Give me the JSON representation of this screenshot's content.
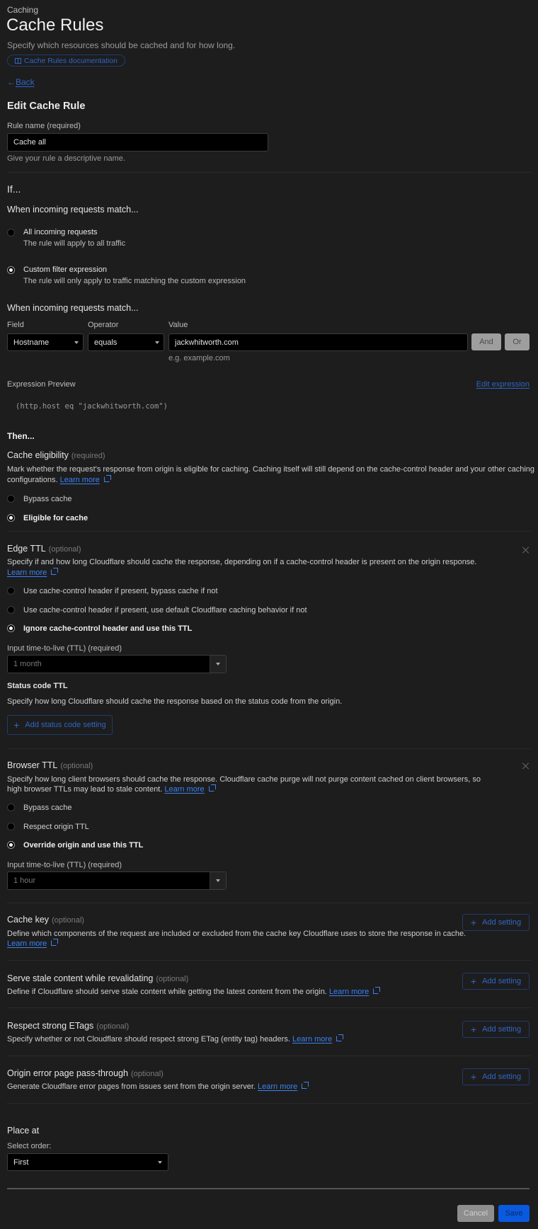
{
  "header": {
    "breadcrumb": "Caching",
    "title": "Cache Rules",
    "subtitle": "Specify which resources should be cached and for how long.",
    "doc_link": "Cache Rules documentation",
    "back": "Back"
  },
  "form": {
    "title": "Edit Cache Rule",
    "rule_name_label": "Rule name (required)",
    "rule_name_value": "Cache all",
    "rule_name_help": "Give your rule a descriptive name."
  },
  "if": {
    "heading": "If...",
    "match_heading": "When incoming requests match...",
    "options": [
      {
        "label": "All incoming requests",
        "desc": "The rule will apply to all traffic",
        "checked": false
      },
      {
        "label": "Custom filter expression",
        "desc": "The rule will only apply to traffic matching the custom expression",
        "checked": true
      }
    ],
    "match_heading2": "When incoming requests match...",
    "field_label": "Field",
    "operator_label": "Operator",
    "value_label": "Value",
    "field_value": "Hostname",
    "operator_value": "equals",
    "value_value": "jackwhitworth.com",
    "value_hint": "e.g. example.com",
    "and_label": "And",
    "or_label": "Or",
    "preview_label": "Expression Preview",
    "edit_expression": "Edit expression",
    "expression": "(http.host eq \"jackwhitworth.com\")"
  },
  "then": {
    "heading": "Then...",
    "eligibility": {
      "title": "Cache eligibility",
      "tag": "(required)",
      "desc": "Mark whether the request's response from origin is eligible for caching. Caching itself will still depend on the cache-control header and your other caching",
      "desc2": "configurations.",
      "learn_more": "Learn more",
      "options": [
        {
          "label": "Bypass cache",
          "checked": false
        },
        {
          "label": "Eligible for cache",
          "checked": true
        }
      ]
    },
    "edge_ttl": {
      "title": "Edge TTL",
      "tag": "(optional)",
      "desc": "Specify if and how long Cloudflare should cache the response, depending on if a cache-control header is present on the origin response.",
      "learn_more": "Learn more",
      "options": [
        {
          "label": "Use cache-control header if present, bypass cache if not",
          "checked": false
        },
        {
          "label": "Use cache-control header if present, use default Cloudflare caching behavior if not",
          "checked": false
        },
        {
          "label": "Ignore cache-control header and use this TTL",
          "checked": true
        }
      ],
      "ttl_label": "Input time-to-live (TTL) (required)",
      "ttl_value": "1 month",
      "status_title": "Status code TTL",
      "status_desc": "Specify how long Cloudflare should cache the response based on the status code from the origin.",
      "add_status": "Add status code setting"
    },
    "browser_ttl": {
      "title": "Browser TTL",
      "tag": "(optional)",
      "desc": "Specify how long client browsers should cache the response. Cloudflare cache purge will not purge content cached on client browsers, so",
      "desc2": "high browser TTLs may lead to stale content.",
      "learn_more": "Learn more",
      "options": [
        {
          "label": "Bypass cache",
          "checked": false
        },
        {
          "label": "Respect origin TTL",
          "checked": false
        },
        {
          "label": "Override origin and use this TTL",
          "checked": true
        }
      ],
      "ttl_label": "Input time-to-live (TTL) (required)",
      "ttl_value": "1 hour"
    },
    "optional_settings": [
      {
        "title": "Cache key",
        "tag": "(optional)",
        "desc": "Define which components of the request are included or excluded from the cache key Cloudflare uses to store the response in cache.",
        "learn_more": "Learn more",
        "button": "Add setting"
      },
      {
        "title": "Serve stale content while revalidating",
        "tag": "(optional)",
        "desc": "Define if Cloudflare should serve stale content while getting the latest content from the origin.",
        "learn_more": "Learn more",
        "button": "Add setting"
      },
      {
        "title": "Respect strong ETags",
        "tag": "(optional)",
        "desc": "Specify whether or not Cloudflare should respect strong ETag (entity tag) headers.",
        "learn_more": "Learn more",
        "button": "Add setting"
      },
      {
        "title": "Origin error page pass-through",
        "tag": "(optional)",
        "desc": "Generate Cloudflare error pages from issues sent from the origin server.",
        "learn_more": "Learn more",
        "button": "Add setting"
      }
    ]
  },
  "place": {
    "heading": "Place at",
    "label": "Select order:",
    "value": "First"
  },
  "footer": {
    "cancel": "Cancel",
    "save": "Save"
  },
  "colors": {
    "background": "#1d1d1d",
    "accent": "#3b82f6",
    "save": "#0a5adf"
  }
}
